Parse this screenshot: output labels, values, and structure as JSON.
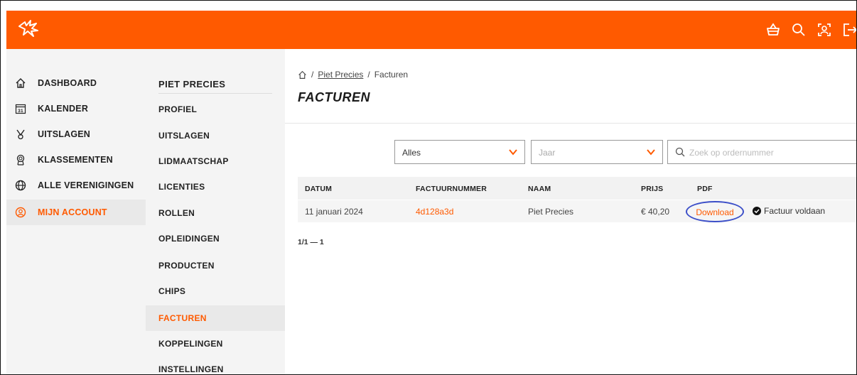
{
  "nav": {
    "items": [
      {
        "label": "DASHBOARD",
        "icon": "home-icon"
      },
      {
        "label": "KALENDER",
        "icon": "calendar-icon",
        "icon_text": "31"
      },
      {
        "label": "UITSLAGEN",
        "icon": "stopwatch-icon"
      },
      {
        "label": "KLASSEMENTEN",
        "icon": "medal-icon"
      },
      {
        "label": "ALLE VERENIGINGEN",
        "icon": "globe-icon"
      },
      {
        "label": "MIJN ACCOUNT",
        "icon": "account-icon",
        "active": true
      }
    ]
  },
  "submenu": {
    "heading": "PIET PRECIES",
    "items": [
      {
        "label": "PROFIEL"
      },
      {
        "label": "UITSLAGEN"
      },
      {
        "label": "LIDMAATSCHAP"
      },
      {
        "label": "LICENTIES"
      },
      {
        "label": "ROLLEN"
      },
      {
        "label": "OPLEIDINGEN"
      },
      {
        "label": "PRODUCTEN"
      },
      {
        "label": "CHIPS"
      },
      {
        "label": "FACTUREN",
        "active": true
      },
      {
        "label": "KOPPELINGEN"
      },
      {
        "label": "INSTELLINGEN"
      }
    ]
  },
  "breadcrumb": {
    "link": "Piet Precies",
    "separator": "/",
    "current": "Facturen"
  },
  "page": {
    "title": "FACTUREN"
  },
  "filters": {
    "type_select": "Alles",
    "year_select": "Jaar",
    "search_placeholder": "Zoek op ordernummer"
  },
  "table": {
    "headers": [
      "DATUM",
      "FACTUURNUMMER",
      "NAAM",
      "PRIJS",
      "PDF"
    ],
    "rows": [
      {
        "date": "11 januari 2024",
        "invoice_number": "4d128a3d",
        "name": "Piet Precies",
        "price": "€ 40,20",
        "pdf": "Download",
        "status": "Factuur voldaan"
      }
    ]
  },
  "pagination": "1/1 — 1",
  "colors": {
    "brand": "#ff5a00",
    "annotation_circle": "#3c4fc8"
  }
}
